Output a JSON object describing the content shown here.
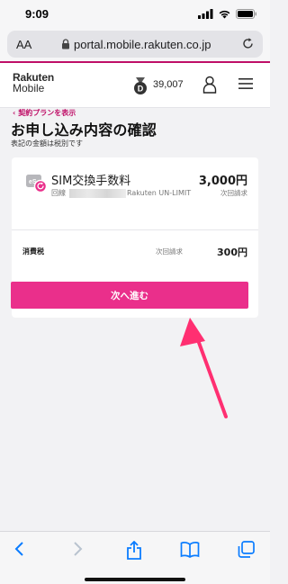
{
  "status_bar": {
    "time": "9:09"
  },
  "browser": {
    "aa_label": "AA",
    "url": "portal.mobile.rakuten.co.jp"
  },
  "site_header": {
    "logo_line1": "Rakuten",
    "logo_line2": "Mobile",
    "points": "39,007",
    "brand_color": "#bf0f67"
  },
  "page": {
    "back_link": "契約プランを表示",
    "title": "お申し込み内容の確認",
    "subnote": "表記の金額は税別です",
    "item": {
      "name": "SIM交換手数料",
      "line_label": "回線",
      "plan": "Rakuten UN-LIMIT",
      "price": "3,000円",
      "billing": "次回請求"
    },
    "tax": {
      "label": "消費税",
      "billing": "次回請求",
      "price": "300円"
    },
    "next_button": "次へ進む",
    "accent_color": "#ea2f8b"
  },
  "icons": {
    "status": [
      "signal-icon",
      "wifi-icon",
      "battery-icon"
    ],
    "url_bar": [
      "lock-icon",
      "reload-icon"
    ],
    "header": [
      "points-badge-icon",
      "user-icon",
      "menu-icon"
    ],
    "bottom_bar": [
      "back-icon",
      "forward-icon",
      "share-icon",
      "bookmarks-icon",
      "tabs-icon"
    ]
  }
}
